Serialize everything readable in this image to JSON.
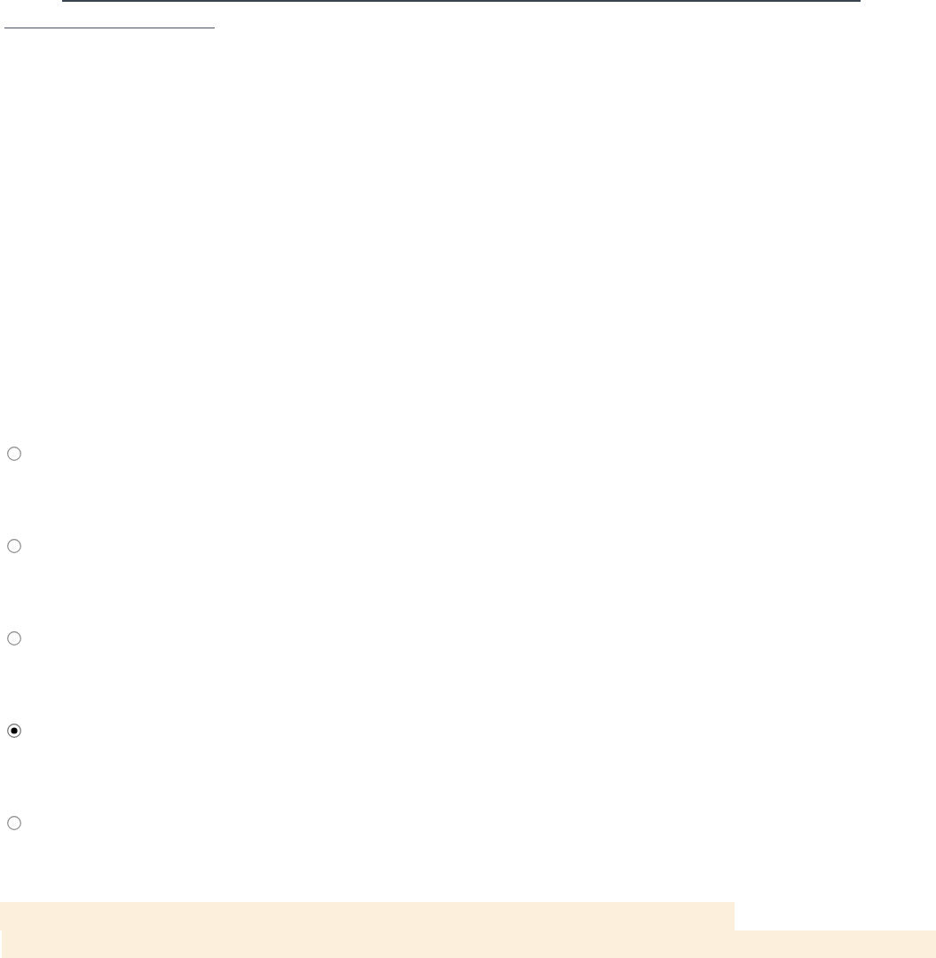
{
  "answer_options": [
    {
      "selected": false
    },
    {
      "selected": false
    },
    {
      "selected": false
    },
    {
      "selected": true
    },
    {
      "selected": false
    }
  ]
}
